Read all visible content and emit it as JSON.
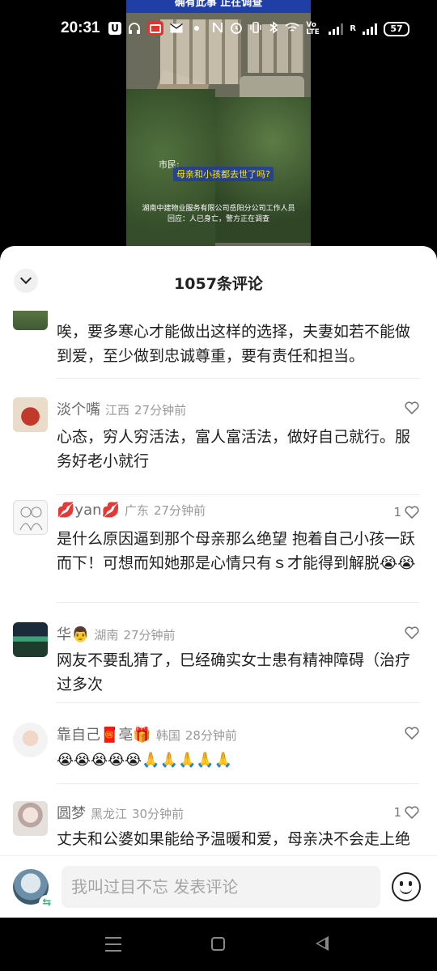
{
  "status_bar": {
    "time": "20:31",
    "u_label": "U",
    "network_label": "Vo LTE",
    "network_label2": "R",
    "battery": "57"
  },
  "video": {
    "top_caption": "确有此事 正在调查",
    "speaker": "市民:",
    "question": "母亲和小孩都去世了吗?",
    "subtitle_line1": "湖南中建物业服务有限公司岳阳分公司工作人员",
    "subtitle_line2": "回应：人已身亡，警方正在调查"
  },
  "comments_panel": {
    "title": "1057条评论",
    "comments": [
      {
        "text": "唉，要多寒心才能做出这样的选择，夫妻如若不能做到爱，至少做到忠诚尊重，要有责任和担当。"
      },
      {
        "name": "淡个嘴",
        "region": "江西",
        "time": "27分钟前",
        "text": "心态，穷人穷活法，富人富活法，做好自己就行。服务好老小就行",
        "likes": ""
      },
      {
        "name": "💋yan💋",
        "region": "广东",
        "time": "27分钟前",
        "text": "是什么原因逼到那个母亲那么绝望  抱着自己小孩一跃而下！可想而知她那是心情只有ｓ才能得到解脱😭😭",
        "likes": "1"
      },
      {
        "name": "华👨",
        "region": "湖南",
        "time": "27分钟前",
        "text": "网友不要乱猜了，巳经确实女士患有精神障碍（治疗过多次",
        "likes": ""
      },
      {
        "name": "靠自己🧧亳🎁",
        "region": "韩国",
        "time": "28分钟前",
        "text": "😭😭😭😭😭🙏🙏🙏🙏🙏",
        "likes": ""
      },
      {
        "name": "圆梦",
        "region": "黑龙江",
        "time": "30分钟前",
        "text": "丈夫和公婆如果能给予温暖和爱，母亲决不会走上绝路，而且把心爱的孩子一起带走，留下孩子没人",
        "likes": "1"
      }
    ]
  },
  "input_bar": {
    "placeholder": "我叫过目不忘 发表评论",
    "swap_icon": "⇆"
  }
}
